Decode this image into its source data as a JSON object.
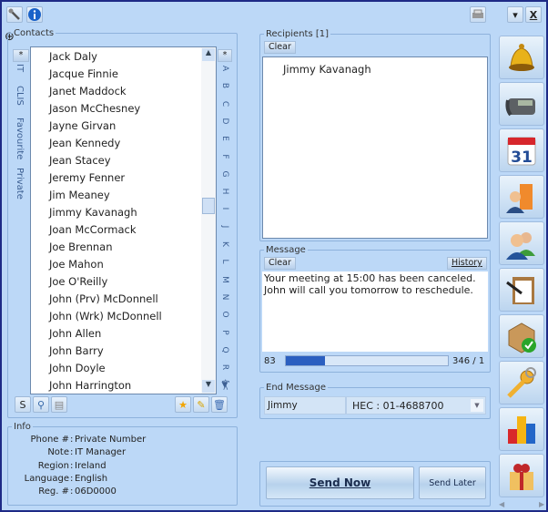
{
  "toolbar": {
    "tools_icon": "wrench-icon",
    "info_icon": "info-icon",
    "print_icon": "printer-icon",
    "minimize_label": "▾",
    "close_label": "X"
  },
  "contacts": {
    "legend": "Contacts",
    "group_tabs": [
      "*",
      "IT",
      "CLIS",
      "Favourite",
      "Private"
    ],
    "items": [
      "Jack Daly",
      "Jacque Finnie",
      "Janet Maddock",
      "Jason McChesney",
      "Jayne Girvan",
      "Jean Kennedy",
      "Jean Stacey",
      "Jeremy Fenner",
      "Jim Meaney",
      "Jimmy Kavanagh",
      "Joan McCormack",
      "Joe Brennan",
      "Joe Mahon",
      "Joe O'Reilly",
      "John (Prv) McDonnell",
      "John (Wrk) McDonnell",
      "John Allen",
      "John Barry",
      "John Doyle",
      "John Harrington"
    ],
    "alpha_index": [
      "*",
      "A",
      "B",
      "C",
      "D",
      "E",
      "F",
      "G",
      "H",
      "I",
      "J",
      "K",
      "L",
      "M",
      "N",
      "O",
      "P",
      "Q",
      "R",
      "{<"
    ],
    "bottom_left_buttons": [
      "S",
      "find-contact-icon",
      "printer-icon"
    ],
    "bottom_right_buttons": [
      "star-icon",
      "pencil-icon",
      "trash-icon"
    ]
  },
  "info": {
    "legend": "Info",
    "rows": [
      {
        "label": "Phone #",
        "value": "Private Number"
      },
      {
        "label": "Note",
        "value": "IT Manager"
      },
      {
        "label": "Region",
        "value": "Ireland"
      },
      {
        "label": "Language",
        "value": "English"
      },
      {
        "label": "Reg. #",
        "value": "06D0000"
      }
    ]
  },
  "recipients": {
    "legend": "Recipients [1]",
    "clear_label": "Clear",
    "items": [
      "Jimmy Kavanagh"
    ]
  },
  "message": {
    "legend": "Message",
    "clear_label": "Clear",
    "history_label": "History",
    "text_line1": "Your meeting at 15:00 has been canceled.",
    "text_line2": "John will call you tomorrow to reschedule.",
    "char_count": "83",
    "progress_fraction": 0.24,
    "counter": "346 / 1"
  },
  "end_message": {
    "legend": "End Message",
    "name": "Jimmy",
    "selected": "HEC : 01-4688700"
  },
  "actions": {
    "send_now": "Send Now",
    "send_later": "Send Later"
  },
  "side_icons": [
    "bell-icon",
    "phone-icon",
    "calendar-icon",
    "company-contacts-icon",
    "people-icon",
    "clipboard-icon",
    "package-check-icon",
    "key-icon",
    "bar-chart-icon",
    "gift-icon"
  ],
  "calendar_day": "31"
}
